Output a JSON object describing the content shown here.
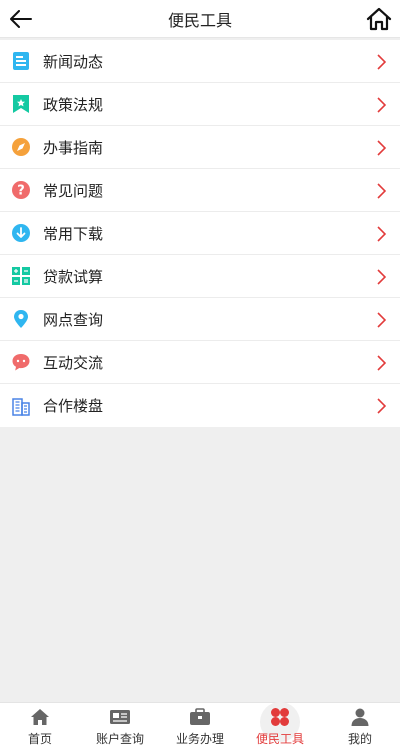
{
  "header": {
    "title": "便民工具",
    "back_icon": "arrow-left-icon",
    "home_icon": "home-icon"
  },
  "menu": [
    {
      "label": "新闻动态",
      "icon": "news-icon",
      "color": "#2fb6f0"
    },
    {
      "label": "政策法规",
      "icon": "policy-bookmark-icon",
      "color": "#14c9a2"
    },
    {
      "label": "办事指南",
      "icon": "compass-icon",
      "color": "#f5a13b"
    },
    {
      "label": "常见问题",
      "icon": "question-icon",
      "color": "#f06b6b"
    },
    {
      "label": "常用下载",
      "icon": "download-icon",
      "color": "#2fb6f0"
    },
    {
      "label": "贷款试算",
      "icon": "calculator-icon",
      "color": "#14c9a2"
    },
    {
      "label": "网点查询",
      "icon": "location-pin-icon",
      "color": "#2fb6f0"
    },
    {
      "label": "互动交流",
      "icon": "chat-bubble-icon",
      "color": "#f06b6b"
    },
    {
      "label": "合作楼盘",
      "icon": "building-icon",
      "color": "#4a84e6"
    }
  ],
  "tabbar": {
    "items": [
      {
        "label": "首页",
        "icon": "home-icon"
      },
      {
        "label": "账户查询",
        "icon": "id-card-icon"
      },
      {
        "label": "业务办理",
        "icon": "briefcase-icon"
      },
      {
        "label": "便民工具",
        "icon": "clover-icon"
      },
      {
        "label": "我的",
        "icon": "person-icon"
      }
    ],
    "active": "便民工具",
    "active_color": "#e23b3b"
  }
}
